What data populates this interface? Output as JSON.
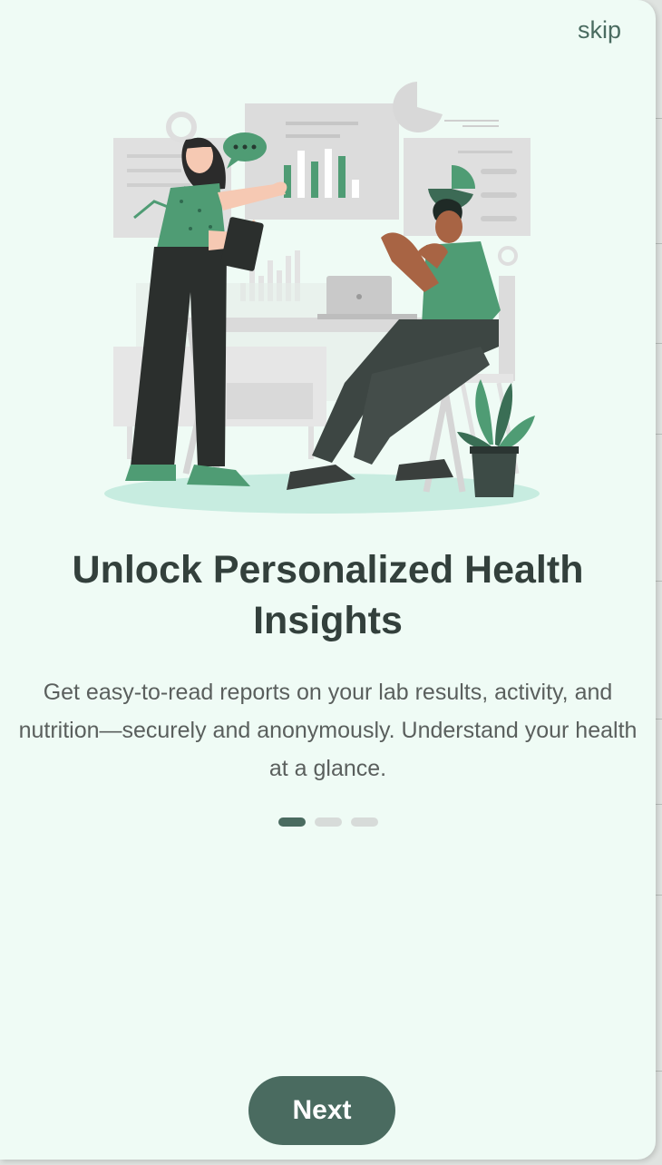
{
  "header": {
    "skip_label": "skip"
  },
  "slide": {
    "title": "Unlock Personalized Health Insights",
    "description": "Get easy-to-read reports on your lab results, activity, and nutrition—securely and anonymously. Understand your health at a glance.",
    "illustration": "analytics-team-illustration",
    "current_page": 1,
    "total_pages": 3
  },
  "footer": {
    "next_label": "Next"
  },
  "colors": {
    "background": "#effbf5",
    "primary": "#4a6b60",
    "title_text": "#33403c",
    "body_text": "#5a5f5d",
    "dot_inactive": "#d7dbd9",
    "accent_green": "#4f9c74"
  }
}
